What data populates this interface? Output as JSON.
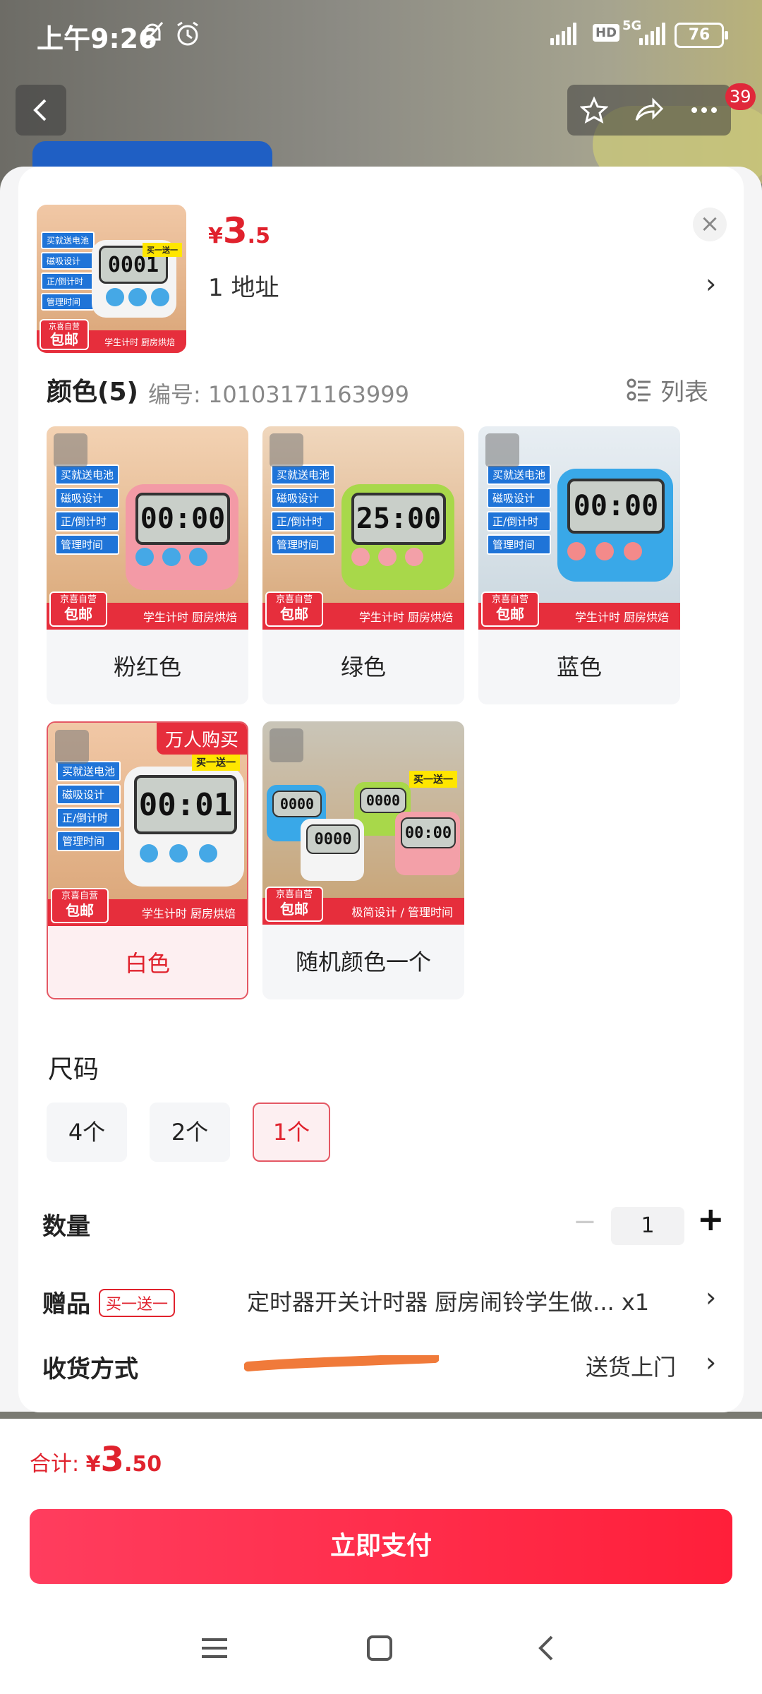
{
  "status_bar": {
    "time": "上午9:26",
    "battery": "76",
    "network": "5G",
    "hd": "HD"
  },
  "top_bar": {
    "badge_count": "39"
  },
  "product": {
    "price_symbol": "¥",
    "price_int": "3",
    "price_dec": ".5",
    "address_line": "1  地址"
  },
  "colors": {
    "title": "颜色(5)",
    "code": "编号: 10103171163999",
    "list_label": "列表",
    "options": [
      {
        "label": "粉红色",
        "screen": "00:00",
        "body_color": "#f39aa6",
        "selected": false
      },
      {
        "label": "绿色",
        "screen": "25:00",
        "body_color": "#a8d84a",
        "selected": false
      },
      {
        "label": "蓝色",
        "screen": "00:00",
        "body_color": "#39a8e8",
        "selected": false
      },
      {
        "label": "白色",
        "screen": "00:01",
        "body_color": "#f4f4f4",
        "selected": true,
        "hot_tag": "万人购买",
        "promo": "买一送一"
      },
      {
        "label": "随机颜色一个",
        "screen": "00:00",
        "body_color": "#f0f0f0",
        "selected": false,
        "promo": "买一送一"
      }
    ],
    "art": {
      "tags": [
        "买就送电池",
        "磁吸设计",
        "正/倒计时",
        "管理时间"
      ],
      "self_top": "京喜自营",
      "self_bottom": "包邮",
      "footer_text": "学生计时  厨房烘焙",
      "footer_text_alt": "极简设计 / 管理时间"
    }
  },
  "size": {
    "title": "尺码",
    "options": [
      "4个",
      "2个",
      "1个"
    ],
    "selected_index": 2
  },
  "quantity": {
    "label": "数量",
    "minus": "−",
    "value": "1",
    "plus": "+"
  },
  "gift": {
    "label": "赠品",
    "tag": "买一送一",
    "text": "定时器开关计时器 厨房闹铃学生做... x1"
  },
  "shipping": {
    "label": "收货方式",
    "value": "送货上门"
  },
  "footer": {
    "total_label": "合计: ",
    "total_yen": "¥",
    "total_int": "3",
    "total_dec": ".50",
    "pay_label": "立即支付"
  },
  "theme": {
    "accent": "#e0222d",
    "pay_gradient": [
      "#ff3d5e",
      "#ff1f3a"
    ]
  }
}
